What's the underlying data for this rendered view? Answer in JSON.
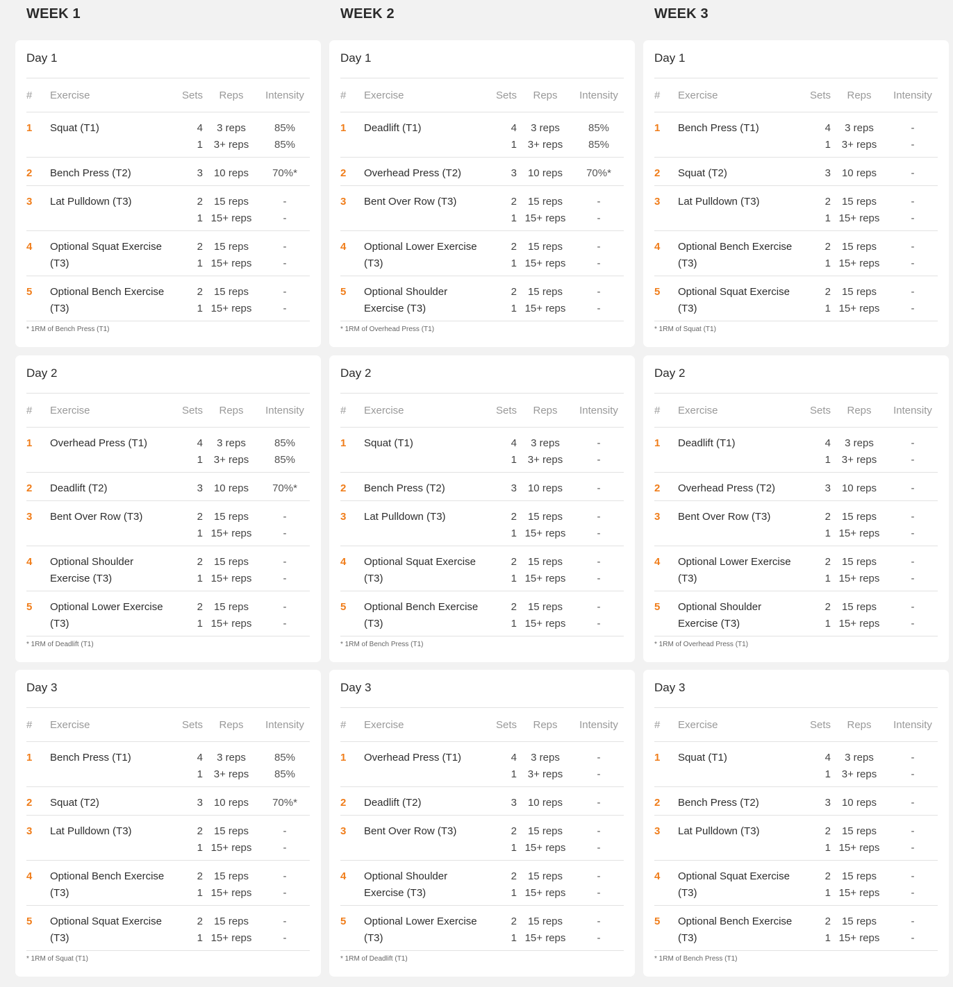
{
  "headers": {
    "num": "#",
    "exercise": "Exercise",
    "sets": "Sets",
    "reps": "Reps",
    "intensity": "Intensity"
  },
  "weeks": [
    {
      "title": "WEEK 1",
      "days": [
        {
          "title": "Day 1",
          "rows": [
            {
              "num": "1",
              "ex": "Squat (T1)",
              "sets": [
                "4",
                "1"
              ],
              "reps": [
                "3 reps",
                "3+ reps"
              ],
              "int": [
                "85%",
                "85%"
              ]
            },
            {
              "num": "2",
              "ex": "Bench Press (T2)",
              "sets": [
                "3"
              ],
              "reps": [
                "10 reps"
              ],
              "int": [
                "70%*"
              ]
            },
            {
              "num": "3",
              "ex": "Lat Pulldown (T3)",
              "sets": [
                "2",
                "1"
              ],
              "reps": [
                "15 reps",
                "15+ reps"
              ],
              "int": [
                "-",
                "-"
              ]
            },
            {
              "num": "4",
              "ex": "Optional Squat Exercise (T3)",
              "sets": [
                "2",
                "1"
              ],
              "reps": [
                "15 reps",
                "15+ reps"
              ],
              "int": [
                "-",
                "-"
              ]
            },
            {
              "num": "5",
              "ex": "Optional Bench Exercise (T3)",
              "sets": [
                "2",
                "1"
              ],
              "reps": [
                "15 reps",
                "15+ reps"
              ],
              "int": [
                "-",
                "-"
              ]
            }
          ],
          "footnote": "* 1RM of Bench Press (T1)"
        },
        {
          "title": "Day 2",
          "rows": [
            {
              "num": "1",
              "ex": "Overhead Press (T1)",
              "sets": [
                "4",
                "1"
              ],
              "reps": [
                "3 reps",
                "3+ reps"
              ],
              "int": [
                "85%",
                "85%"
              ]
            },
            {
              "num": "2",
              "ex": "Deadlift (T2)",
              "sets": [
                "3"
              ],
              "reps": [
                "10 reps"
              ],
              "int": [
                "70%*"
              ]
            },
            {
              "num": "3",
              "ex": "Bent Over Row (T3)",
              "sets": [
                "2",
                "1"
              ],
              "reps": [
                "15 reps",
                "15+ reps"
              ],
              "int": [
                "-",
                "-"
              ]
            },
            {
              "num": "4",
              "ex": "Optional Shoulder Exercise (T3)",
              "sets": [
                "2",
                "1"
              ],
              "reps": [
                "15 reps",
                "15+ reps"
              ],
              "int": [
                "-",
                "-"
              ]
            },
            {
              "num": "5",
              "ex": "Optional Lower Exercise (T3)",
              "sets": [
                "2",
                "1"
              ],
              "reps": [
                "15 reps",
                "15+ reps"
              ],
              "int": [
                "-",
                "-"
              ]
            }
          ],
          "footnote": "* 1RM of Deadlift (T1)"
        },
        {
          "title": "Day 3",
          "rows": [
            {
              "num": "1",
              "ex": "Bench Press (T1)",
              "sets": [
                "4",
                "1"
              ],
              "reps": [
                "3 reps",
                "3+ reps"
              ],
              "int": [
                "85%",
                "85%"
              ]
            },
            {
              "num": "2",
              "ex": "Squat (T2)",
              "sets": [
                "3"
              ],
              "reps": [
                "10 reps"
              ],
              "int": [
                "70%*"
              ]
            },
            {
              "num": "3",
              "ex": "Lat Pulldown (T3)",
              "sets": [
                "2",
                "1"
              ],
              "reps": [
                "15 reps",
                "15+ reps"
              ],
              "int": [
                "-",
                "-"
              ]
            },
            {
              "num": "4",
              "ex": "Optional Bench Exercise (T3)",
              "sets": [
                "2",
                "1"
              ],
              "reps": [
                "15 reps",
                "15+ reps"
              ],
              "int": [
                "-",
                "-"
              ]
            },
            {
              "num": "5",
              "ex": "Optional Squat Exercise (T3)",
              "sets": [
                "2",
                "1"
              ],
              "reps": [
                "15 reps",
                "15+ reps"
              ],
              "int": [
                "-",
                "-"
              ]
            }
          ],
          "footnote": "* 1RM of Squat (T1)"
        }
      ]
    },
    {
      "title": "WEEK 2",
      "days": [
        {
          "title": "Day 1",
          "rows": [
            {
              "num": "1",
              "ex": "Deadlift (T1)",
              "sets": [
                "4",
                "1"
              ],
              "reps": [
                "3 reps",
                "3+ reps"
              ],
              "int": [
                "85%",
                "85%"
              ]
            },
            {
              "num": "2",
              "ex": "Overhead Press (T2)",
              "sets": [
                "3"
              ],
              "reps": [
                "10 reps"
              ],
              "int": [
                "70%*"
              ]
            },
            {
              "num": "3",
              "ex": "Bent Over Row (T3)",
              "sets": [
                "2",
                "1"
              ],
              "reps": [
                "15 reps",
                "15+ reps"
              ],
              "int": [
                "-",
                "-"
              ]
            },
            {
              "num": "4",
              "ex": "Optional Lower Exercise (T3)",
              "sets": [
                "2",
                "1"
              ],
              "reps": [
                "15 reps",
                "15+ reps"
              ],
              "int": [
                "-",
                "-"
              ]
            },
            {
              "num": "5",
              "ex": "Optional Shoulder Exercise (T3)",
              "sets": [
                "2",
                "1"
              ],
              "reps": [
                "15 reps",
                "15+ reps"
              ],
              "int": [
                "-",
                "-"
              ]
            }
          ],
          "footnote": "* 1RM of Overhead Press (T1)"
        },
        {
          "title": "Day 2",
          "rows": [
            {
              "num": "1",
              "ex": "Squat (T1)",
              "sets": [
                "4",
                "1"
              ],
              "reps": [
                "3 reps",
                "3+ reps"
              ],
              "int": [
                "-",
                "-"
              ]
            },
            {
              "num": "2",
              "ex": "Bench Press (T2)",
              "sets": [
                "3"
              ],
              "reps": [
                "10 reps"
              ],
              "int": [
                "-"
              ]
            },
            {
              "num": "3",
              "ex": "Lat Pulldown (T3)",
              "sets": [
                "2",
                "1"
              ],
              "reps": [
                "15 reps",
                "15+ reps"
              ],
              "int": [
                "-",
                "-"
              ]
            },
            {
              "num": "4",
              "ex": "Optional Squat Exercise (T3)",
              "sets": [
                "2",
                "1"
              ],
              "reps": [
                "15 reps",
                "15+ reps"
              ],
              "int": [
                "-",
                "-"
              ]
            },
            {
              "num": "5",
              "ex": "Optional Bench Exercise (T3)",
              "sets": [
                "2",
                "1"
              ],
              "reps": [
                "15 reps",
                "15+ reps"
              ],
              "int": [
                "-",
                "-"
              ]
            }
          ],
          "footnote": "* 1RM of Bench Press (T1)"
        },
        {
          "title": "Day 3",
          "rows": [
            {
              "num": "1",
              "ex": "Overhead Press (T1)",
              "sets": [
                "4",
                "1"
              ],
              "reps": [
                "3 reps",
                "3+ reps"
              ],
              "int": [
                "-",
                "-"
              ]
            },
            {
              "num": "2",
              "ex": "Deadlift (T2)",
              "sets": [
                "3"
              ],
              "reps": [
                "10 reps"
              ],
              "int": [
                "-"
              ]
            },
            {
              "num": "3",
              "ex": "Bent Over Row (T3)",
              "sets": [
                "2",
                "1"
              ],
              "reps": [
                "15 reps",
                "15+ reps"
              ],
              "int": [
                "-",
                "-"
              ]
            },
            {
              "num": "4",
              "ex": "Optional Shoulder Exercise (T3)",
              "sets": [
                "2",
                "1"
              ],
              "reps": [
                "15 reps",
                "15+ reps"
              ],
              "int": [
                "-",
                "-"
              ]
            },
            {
              "num": "5",
              "ex": "Optional Lower Exercise (T3)",
              "sets": [
                "2",
                "1"
              ],
              "reps": [
                "15 reps",
                "15+ reps"
              ],
              "int": [
                "-",
                "-"
              ]
            }
          ],
          "footnote": "* 1RM of Deadlift (T1)"
        }
      ]
    },
    {
      "title": "WEEK 3",
      "days": [
        {
          "title": "Day 1",
          "rows": [
            {
              "num": "1",
              "ex": "Bench Press (T1)",
              "sets": [
                "4",
                "1"
              ],
              "reps": [
                "3 reps",
                "3+ reps"
              ],
              "int": [
                "-",
                "-"
              ]
            },
            {
              "num": "2",
              "ex": "Squat (T2)",
              "sets": [
                "3"
              ],
              "reps": [
                "10 reps"
              ],
              "int": [
                "-"
              ]
            },
            {
              "num": "3",
              "ex": "Lat Pulldown (T3)",
              "sets": [
                "2",
                "1"
              ],
              "reps": [
                "15 reps",
                "15+ reps"
              ],
              "int": [
                "-",
                "-"
              ]
            },
            {
              "num": "4",
              "ex": "Optional Bench Exercise (T3)",
              "sets": [
                "2",
                "1"
              ],
              "reps": [
                "15 reps",
                "15+ reps"
              ],
              "int": [
                "-",
                "-"
              ]
            },
            {
              "num": "5",
              "ex": "Optional Squat Exercise (T3)",
              "sets": [
                "2",
                "1"
              ],
              "reps": [
                "15 reps",
                "15+ reps"
              ],
              "int": [
                "-",
                "-"
              ]
            }
          ],
          "footnote": "* 1RM of Squat (T1)"
        },
        {
          "title": "Day 2",
          "rows": [
            {
              "num": "1",
              "ex": "Deadlift (T1)",
              "sets": [
                "4",
                "1"
              ],
              "reps": [
                "3 reps",
                "3+ reps"
              ],
              "int": [
                "-",
                "-"
              ]
            },
            {
              "num": "2",
              "ex": "Overhead Press (T2)",
              "sets": [
                "3"
              ],
              "reps": [
                "10 reps"
              ],
              "int": [
                "-"
              ]
            },
            {
              "num": "3",
              "ex": "Bent Over Row (T3)",
              "sets": [
                "2",
                "1"
              ],
              "reps": [
                "15 reps",
                "15+ reps"
              ],
              "int": [
                "-",
                "-"
              ]
            },
            {
              "num": "4",
              "ex": "Optional Lower Exercise (T3)",
              "sets": [
                "2",
                "1"
              ],
              "reps": [
                "15 reps",
                "15+ reps"
              ],
              "int": [
                "-",
                "-"
              ]
            },
            {
              "num": "5",
              "ex": "Optional Shoulder Exercise (T3)",
              "sets": [
                "2",
                "1"
              ],
              "reps": [
                "15 reps",
                "15+ reps"
              ],
              "int": [
                "-",
                "-"
              ]
            }
          ],
          "footnote": "* 1RM of Overhead Press (T1)"
        },
        {
          "title": "Day 3",
          "rows": [
            {
              "num": "1",
              "ex": "Squat (T1)",
              "sets": [
                "4",
                "1"
              ],
              "reps": [
                "3 reps",
                "3+ reps"
              ],
              "int": [
                "-",
                "-"
              ]
            },
            {
              "num": "2",
              "ex": "Bench Press (T2)",
              "sets": [
                "3"
              ],
              "reps": [
                "10 reps"
              ],
              "int": [
                "-"
              ]
            },
            {
              "num": "3",
              "ex": "Lat Pulldown (T3)",
              "sets": [
                "2",
                "1"
              ],
              "reps": [
                "15 reps",
                "15+ reps"
              ],
              "int": [
                "-",
                "-"
              ]
            },
            {
              "num": "4",
              "ex": "Optional Squat Exercise (T3)",
              "sets": [
                "2",
                "1"
              ],
              "reps": [
                "15 reps",
                "15+ reps"
              ],
              "int": [
                "-",
                "-"
              ]
            },
            {
              "num": "5",
              "ex": "Optional Bench Exercise (T3)",
              "sets": [
                "2",
                "1"
              ],
              "reps": [
                "15 reps",
                "15+ reps"
              ],
              "int": [
                "-",
                "-"
              ]
            }
          ],
          "footnote": "* 1RM of Bench Press (T1)"
        }
      ]
    }
  ]
}
